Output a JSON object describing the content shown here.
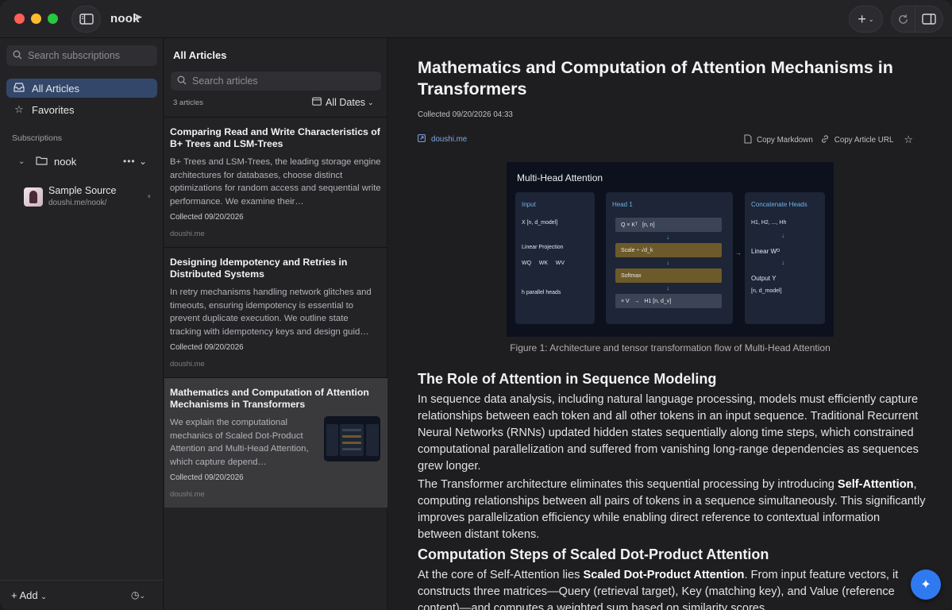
{
  "app": {
    "name": "nook",
    "colors": {
      "accent": "#2f7af0",
      "active_item": "#33476b",
      "link": "#7fa8e6"
    }
  },
  "titlebar": {
    "sidebar_toggle_icon": "sidebar-icon",
    "add_icon": "plus-icon",
    "refresh_icon": "refresh-icon",
    "panel_icon": "panel-icon"
  },
  "sidebar": {
    "search_placeholder": "Search subscriptions",
    "items": [
      {
        "label": "All Articles",
        "icon": "inbox-icon",
        "active": true
      },
      {
        "label": "Favorites",
        "icon": "star-icon",
        "active": false
      }
    ],
    "section_label": "Subscriptions",
    "folder": {
      "label": "nook",
      "more": "•••"
    },
    "source": {
      "name": "Sample Source",
      "url": "doushi.me/nook/"
    },
    "add_label": "Add"
  },
  "list": {
    "title": "All Articles",
    "search_placeholder": "Search articles",
    "count": "3 articles",
    "date_filter": "All Dates",
    "articles": [
      {
        "title": "Comparing Read and Write Characteristics of B+ Trees and LSM-Trees",
        "excerpt": "B+ Trees and LSM-Trees, the leading storage engine architectures for databases, choose distinct optimizations for random access and sequential write performance. We examine their…",
        "collected": "Collected 09/20/2026",
        "source": "doushi.me"
      },
      {
        "title": "Designing Idempotency and Retries in Distributed Systems",
        "excerpt": "In retry mechanisms handling network glitches and timeouts, ensuring idempotency is essential to prevent duplicate execution. We outline state tracking with idempotency keys and design guid…",
        "collected": "Collected 09/20/2026",
        "source": "doushi.me"
      },
      {
        "title": "Mathematics and Computation of Attention Mechanisms in Transformers",
        "excerpt": "We explain the computational mechanics of Scaled Dot-Product Attention and Multi-Head Attention, which capture depend…",
        "collected": "Collected 09/20/2026",
        "source": "doushi.me"
      }
    ]
  },
  "reader": {
    "title": "Mathematics and Computation of Attention Mechanisms in Transformers",
    "collected": "Collected 09/20/2026 04:33",
    "domain": "doushi.me",
    "copy_markdown": "Copy Markdown",
    "copy_url": "Copy Article URL",
    "figure": {
      "title": "Multi-Head Attention",
      "input_head": "Input",
      "input_shape": "X  [n, d_model]",
      "linear_projection": "Linear Projection",
      "weights": "WQ     WK     WV",
      "heads_note": "h parallel heads",
      "head1": "Head 1",
      "step1": "Q × Kᵀ   [n, n]",
      "step2": "Scale ÷ √d_k",
      "step3": "Softmax",
      "step4": "× V   →   H1 [n, d_v]",
      "concat_head": "Concatenate Heads",
      "concat_list": "H1, H2, ..., Hh",
      "linear_wo": "Linear Wᴼ",
      "output": "Output Y",
      "output_shape": "[n, d_model]",
      "caption": "Figure 1: Architecture and tensor transformation flow of Multi-Head Attention"
    },
    "h2_1": "The Role of Attention in Sequence Modeling",
    "p1": "In sequence data analysis, including natural language processing, models must efficiently capture relationships between each token and all other tokens in an input sequence. Traditional Recurrent Neural Networks (RNNs) updated hidden states sequentially along time steps, which constrained computational parallelization and suffered from vanishing long-range dependencies as sequences grew longer.",
    "p2_a": "The Transformer architecture eliminates this sequential processing by introducing ",
    "p2_b": "Self-Attention",
    "p2_c": ", computing relationships between all pairs of tokens in a sequence simultaneously. This significantly improves parallelization efficiency while enabling direct reference to contextual information between distant tokens.",
    "h2_2": "Computation Steps of Scaled Dot-Product Attention",
    "p3_a": "At the core of Self-Attention lies ",
    "p3_b": "Scaled Dot-Product Attention",
    "p3_c": ". From input feature vectors, it constructs three matrices—Query (retrieval target), Key (matching key), and Value (reference content)—and computes a weighted sum based on similarity scores."
  }
}
